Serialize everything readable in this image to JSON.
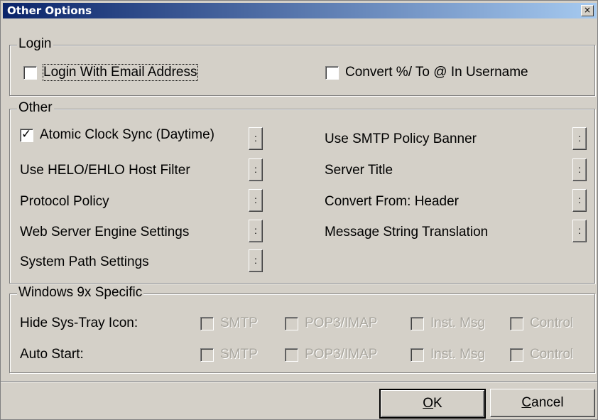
{
  "window": {
    "title": "Other Options",
    "close_glyph": "×"
  },
  "login": {
    "legend": "Login",
    "email_login": {
      "label": "Login With Email Address",
      "checked": false
    },
    "convert_percent": {
      "label": "Convert %/ To @ In Username",
      "checked": false
    }
  },
  "other": {
    "legend": "Other",
    "atomic_clock": {
      "label": "Atomic Clock Sync (Daytime)",
      "checked": true
    },
    "left_items": [
      "Use HELO/EHLO Host Filter",
      "Protocol Policy",
      "Web Server Engine Settings",
      "System Path Settings"
    ],
    "right_items": [
      "Use SMTP Policy Banner",
      "Server Title",
      "Convert From: Header",
      "Message String Translation"
    ],
    "ellipsis": ":"
  },
  "win9x": {
    "legend": "Windows 9x Specific",
    "hide_tray_label": "Hide Sys-Tray Icon:",
    "auto_start_label": "Auto Start:",
    "options": [
      "SMTP",
      "POP3/IMAP",
      "Inst. Msg",
      "Control"
    ]
  },
  "buttons": {
    "ok": "OK",
    "ok_mnemonic": "O",
    "ok_rest": "K",
    "cancel": "Cancel",
    "cancel_mnemonic": "C",
    "cancel_rest": "ancel"
  }
}
